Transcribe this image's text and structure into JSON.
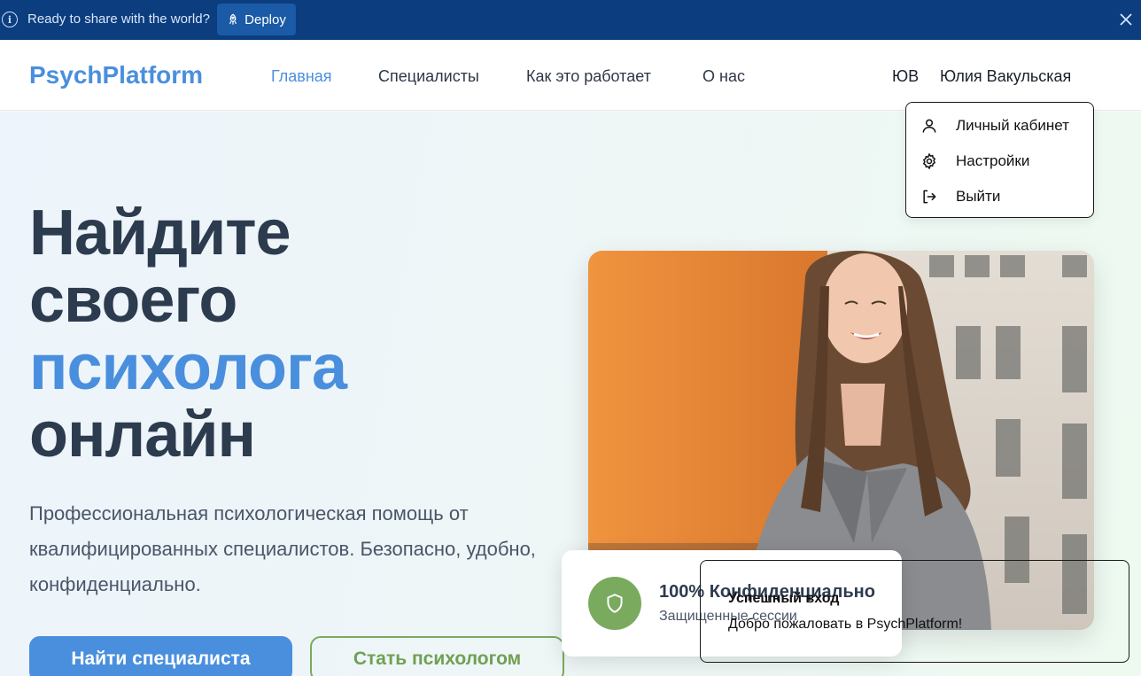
{
  "banner": {
    "message": "Ready to share with the world?",
    "deploy_label": "Deploy",
    "icons": [
      "info-icon",
      "rocket-icon",
      "close-icon"
    ],
    "background": "#0b3d7f"
  },
  "nav": {
    "logo": "PsychPlatform",
    "links": [
      {
        "label": "Главная",
        "active": true
      },
      {
        "label": "Специалисты",
        "active": false
      },
      {
        "label": "Как это работает",
        "active": false
      },
      {
        "label": "О нас",
        "active": false
      }
    ],
    "user": {
      "initials": "ЮВ",
      "name": "Юлия Вакульская"
    }
  },
  "user_menu": {
    "items": [
      {
        "label": "Личный кабинет",
        "icon": "user-icon"
      },
      {
        "label": "Настройки",
        "icon": "gear-icon"
      },
      {
        "label": "Выйти",
        "icon": "logout-icon"
      }
    ]
  },
  "hero": {
    "title_line1": "Найдите",
    "title_line2": "своего",
    "title_accent": "психолога",
    "title_line4": "онлайн",
    "description": "Профессиональная психологическая помощь от квалифицированных специалистов. Безопасно, удобно, конфиденциально.",
    "primary_button": "Найти специалиста",
    "secondary_button": "Стать психологом"
  },
  "confidential_card": {
    "title": "100% Конфиденциально",
    "subtitle": "Защищенные сессии",
    "icon": "shield-icon"
  },
  "toast": {
    "title": "Успешный вход",
    "message": "Добро пожаловать в PsychPlatform!"
  },
  "colors": {
    "accent_blue": "#4a8fdd",
    "accent_green": "#7aaa5e",
    "heading_dark": "#2d3b4e"
  }
}
